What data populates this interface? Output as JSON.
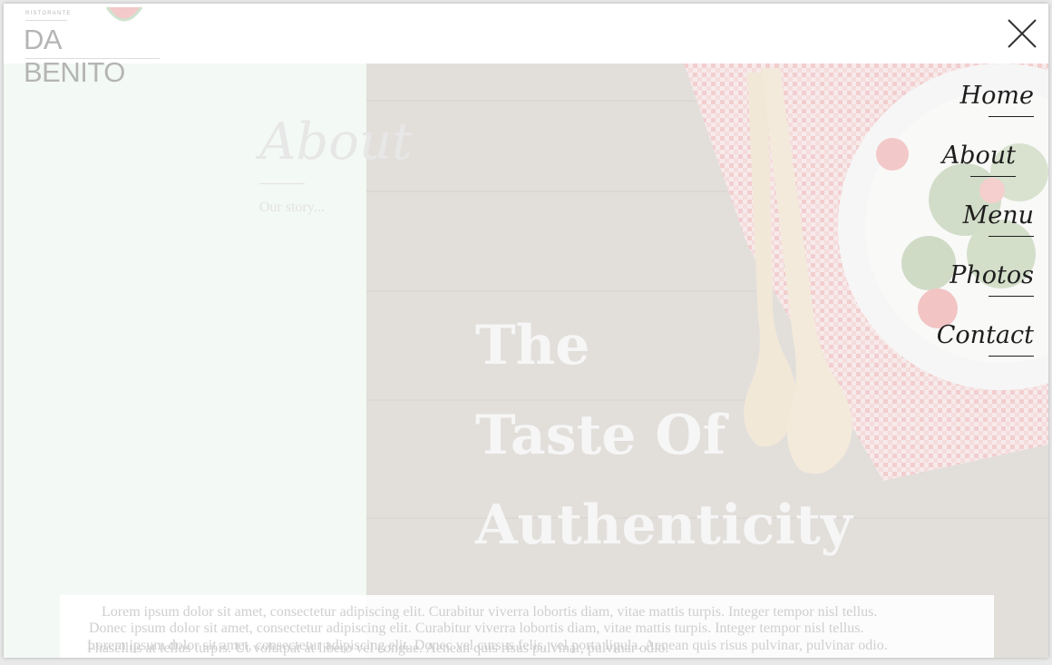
{
  "logo": {
    "small_text": "RISTORANTE",
    "main_text": "DA BENITO"
  },
  "close_icon": "close-x-icon",
  "about": {
    "title": "About",
    "subtitle": "Our story..."
  },
  "hero": {
    "lines": [
      "The",
      "Taste Of",
      "Authenticity"
    ]
  },
  "menu": {
    "items": [
      {
        "label": "Home"
      },
      {
        "label": "About"
      },
      {
        "label": "Menu"
      },
      {
        "label": "Photos"
      },
      {
        "label": "Contact"
      }
    ]
  },
  "body_text": {
    "line1": "Lorem ipsum dolor sit amet, consectetur adipiscing elit. Curabitur viverra lobortis diam, vitae mattis turpis. Integer tempor nisl tellus.",
    "line2": "Donec ipsum dolor sit amet, consectetur adipiscing elit. Curabitur viverra lobortis diam, vitae mattis turpis. Integer tempor nisl tellus.",
    "line3": "Lorem ipsum dolor sit amet, consectetur adipiscing elit. Donec vel cursus felis, vel porta ligula. Aenean quis risus pulvinar, pulvinar odio.",
    "line4": "Phasellus at tellus turpis. Ut volutpat at libero vel congue. Aenean quis risus pulvinar, pulvinar odio."
  },
  "colors": {
    "panel_mint": "#f3f9f4",
    "menu_text": "#1e1e1e",
    "wood": "#dfdcd9",
    "checked_cloth": "#f0c9c9"
  }
}
